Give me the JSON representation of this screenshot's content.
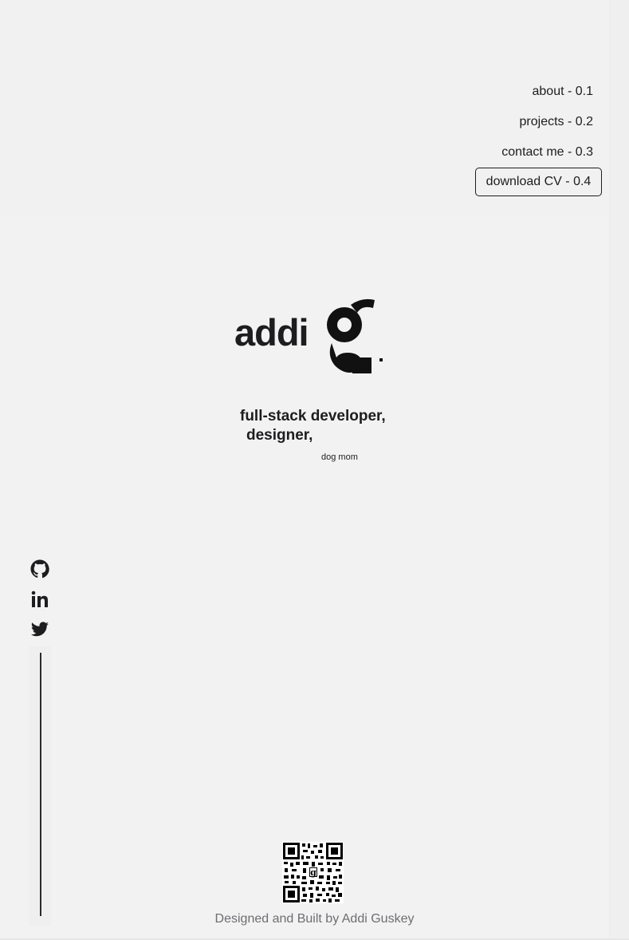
{
  "nav": {
    "items": [
      {
        "label": "about - 0.1"
      },
      {
        "label": "projects - 0.2"
      },
      {
        "label": "contact me - 0.3"
      }
    ],
    "cv_label": "download CV - 0.4"
  },
  "hero": {
    "logo_word": "addi",
    "logo_mark": "g",
    "tagline_line1": "full-stack developer,",
    "tagline_line2": "designer,",
    "tagline_small": "dog mom"
  },
  "social": {
    "icons": [
      "github-icon",
      "linkedin-icon",
      "twitter-icon"
    ]
  },
  "footer": {
    "credit": "Designed and Built by Addi Guskey"
  },
  "colors": {
    "background": "#f2f2f2",
    "text": "#1d1d1f",
    "muted": "#6e6e73"
  }
}
